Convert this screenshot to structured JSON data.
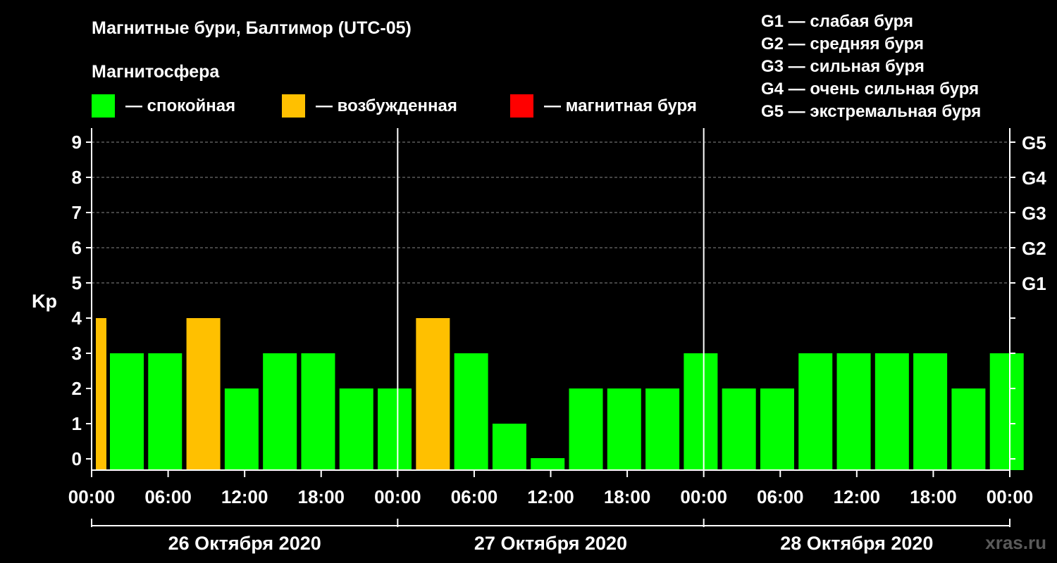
{
  "title": "Магнитные бури, Балтимор (UTC-05)",
  "magnetosphere_label": "Магнитосфера",
  "legend": [
    {
      "label": "— спокойная",
      "color": "#00ff00"
    },
    {
      "label": "— возбужденная",
      "color": "#ffc000"
    },
    {
      "label": "— магнитная буря",
      "color": "#ff0000"
    }
  ],
  "storm_scale": [
    "G1 — слабая буря",
    "G2 — средняя буря",
    "G3 — сильная буря",
    "G4 — очень сильная буря",
    "G5 — экстремальная буря"
  ],
  "watermark": "xras.ru",
  "chart_data": {
    "type": "bar",
    "ylabel": "Kp",
    "ylim": [
      0,
      9
    ],
    "y_ticks": [
      "0",
      "1",
      "2",
      "3",
      "4",
      "5",
      "6",
      "7",
      "8",
      "9"
    ],
    "right_ticks": [
      {
        "kp": 5,
        "label": "G1"
      },
      {
        "kp": 6,
        "label": "G2"
      },
      {
        "kp": 7,
        "label": "G3"
      },
      {
        "kp": 8,
        "label": "G4"
      },
      {
        "kp": 9,
        "label": "G5"
      }
    ],
    "x_tick_labels": [
      "00:00",
      "06:00",
      "12:00",
      "18:00",
      "00:00",
      "06:00",
      "12:00",
      "18:00",
      "00:00",
      "06:00",
      "12:00",
      "18:00",
      "00:00"
    ],
    "dates": [
      "26 Октября 2020",
      "27 Октября 2020",
      "28 Октября 2020"
    ],
    "grid": "horizontal dashed at 5-9",
    "colors": {
      "quiet": "#00ff00",
      "active": "#ffc000",
      "storm": "#ff0000"
    },
    "values": [
      4,
      3,
      3,
      4,
      2,
      3,
      3,
      2,
      2,
      4,
      3,
      1,
      0,
      2,
      2,
      2,
      3,
      2,
      2,
      3,
      3,
      3,
      3,
      2,
      3
    ],
    "levels": [
      "active",
      "quiet",
      "quiet",
      "active",
      "quiet",
      "quiet",
      "quiet",
      "quiet",
      "quiet",
      "active",
      "quiet",
      "quiet",
      "quiet",
      "quiet",
      "quiet",
      "quiet",
      "quiet",
      "quiet",
      "quiet",
      "quiet",
      "quiet",
      "quiet",
      "quiet",
      "quiet",
      "quiet"
    ]
  }
}
